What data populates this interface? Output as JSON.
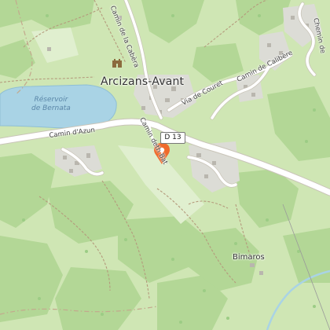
{
  "map": {
    "town": "Arcizans-Avant",
    "lake_line1": "Réservoir",
    "lake_line2": "de Bernata",
    "road_shield": "D 13",
    "roads": {
      "camin_azun": "Camin d'Azun",
      "camin_cabera": "Camin de la Cabèra",
      "via_couret": "Via de Couret",
      "camin_calibere": "Camin de Calibère",
      "cami_debat": "Camin deth Bat",
      "chemin_right": "Chemin de"
    },
    "place": "Bimaros",
    "colors": {
      "background": "#cfe6b4",
      "forest": "#b3d796",
      "water": "#a9d3e5",
      "marker": "#ef6a2b",
      "road": "#ffffff",
      "boundary": "#b59a7c"
    },
    "icons": [
      "castle-icon",
      "location-pin-icon"
    ]
  }
}
